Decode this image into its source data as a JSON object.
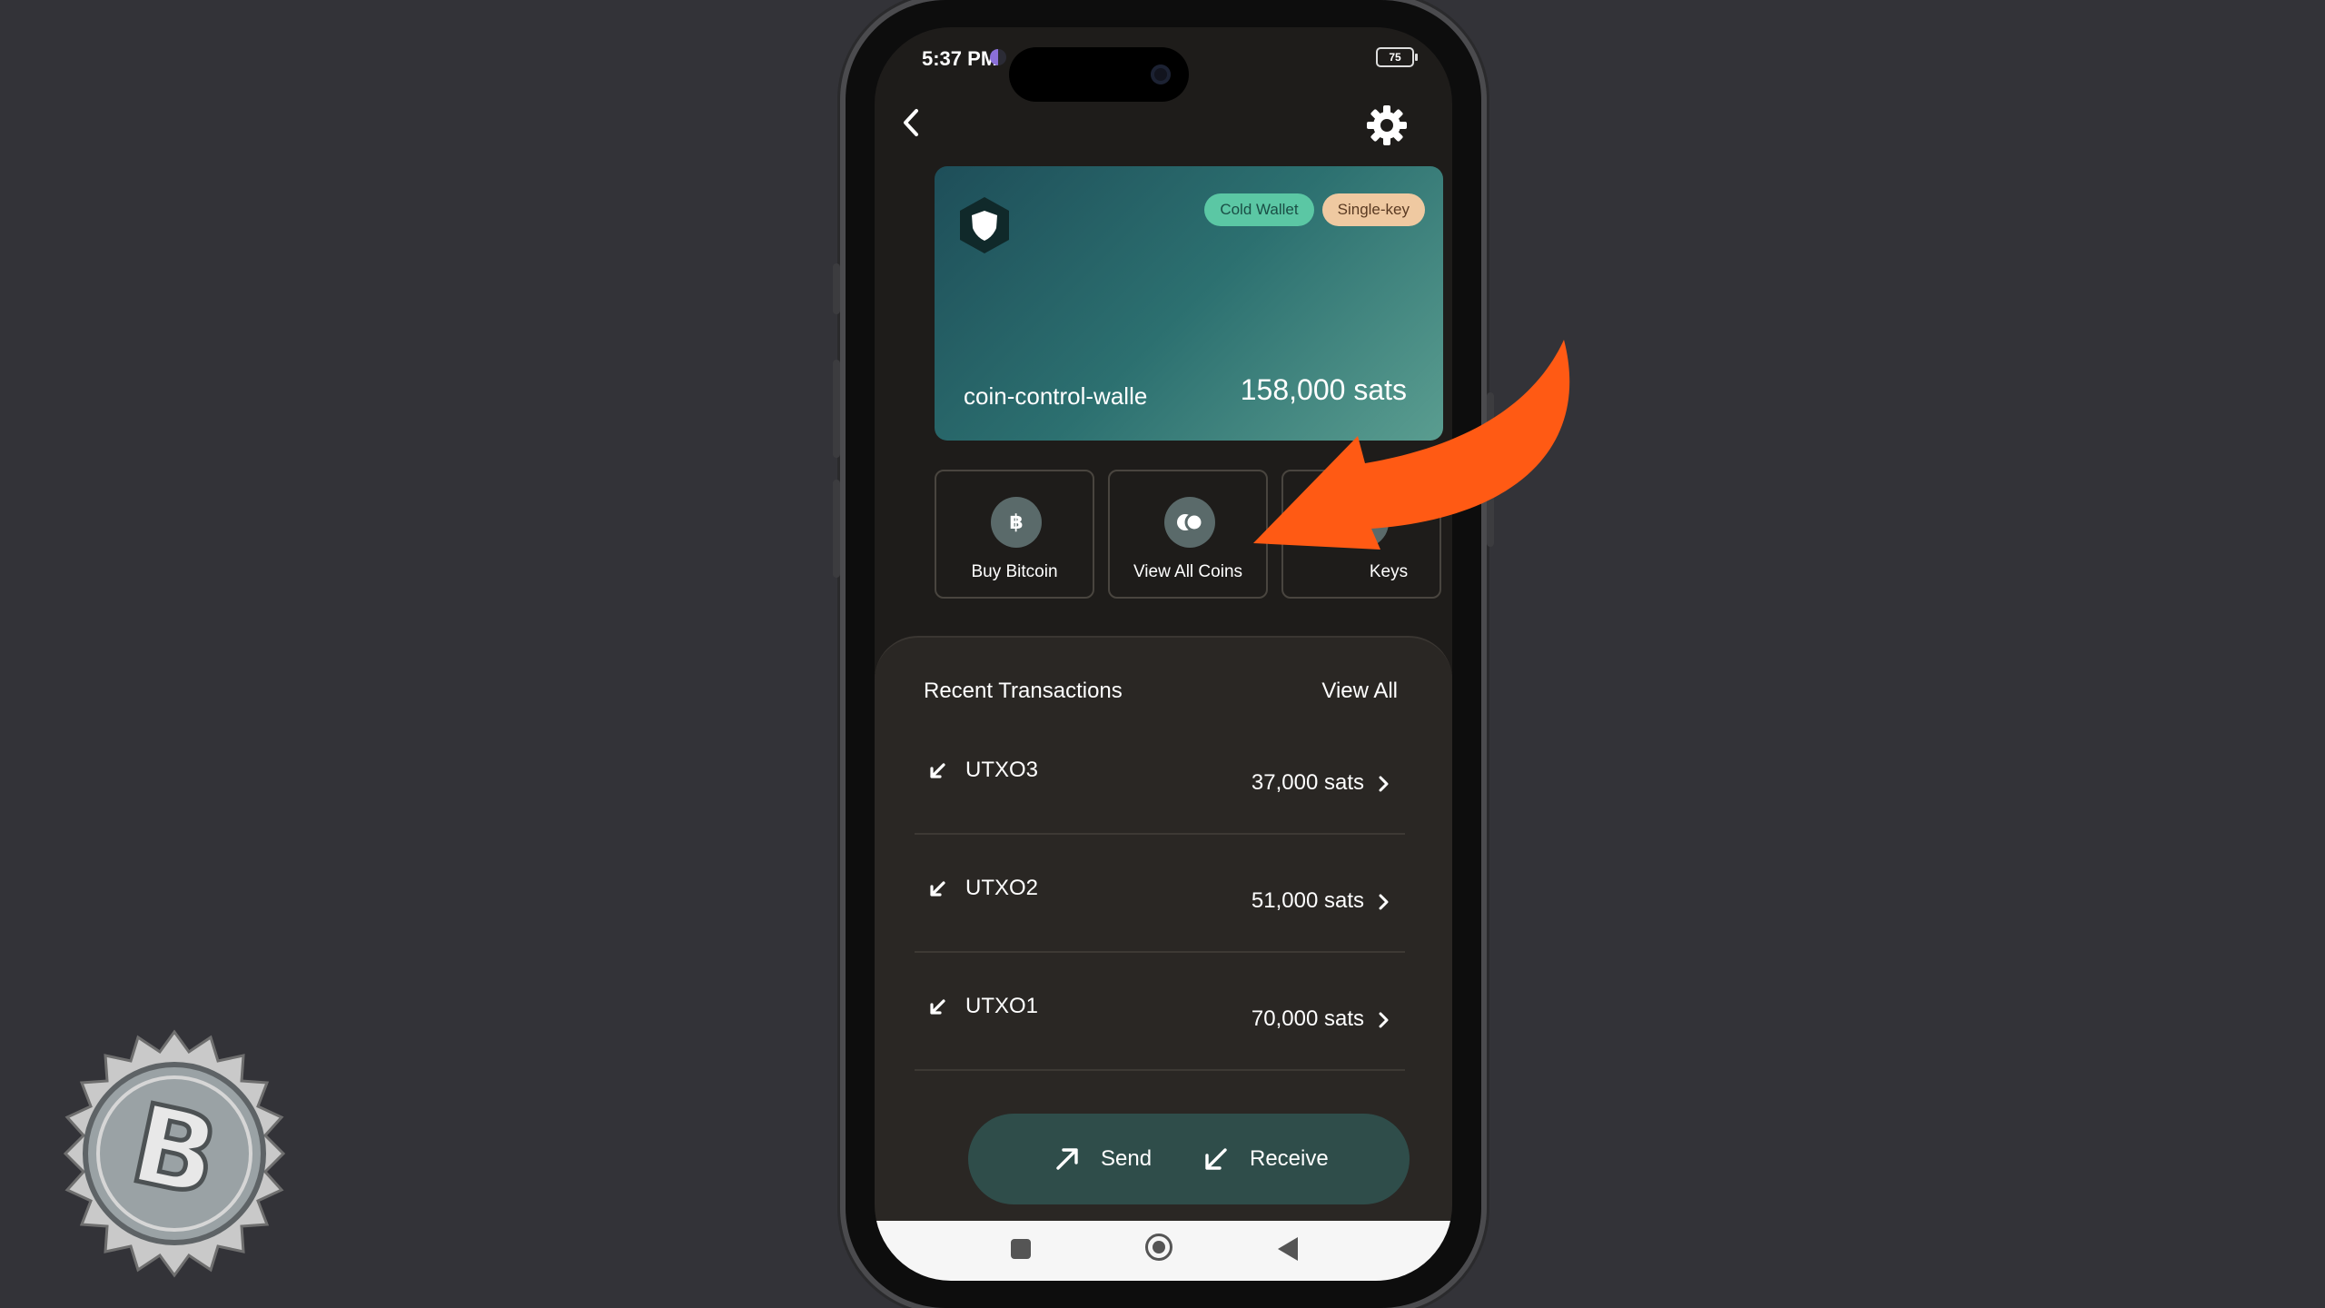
{
  "status_bar": {
    "time": "5:37 PM",
    "battery": "75"
  },
  "wallet": {
    "name": "coin-control-walle",
    "balance": "158,000 sats",
    "badges": [
      "Cold Wallet",
      "Single-key"
    ],
    "colors": {
      "card_start": "#1e4e59",
      "card_end": "#5a9d90",
      "cold_badge": "#5bc7a4",
      "single_badge": "#efc9a1"
    }
  },
  "actions": [
    {
      "label": "Buy Bitcoin",
      "icon": "bitcoin-icon"
    },
    {
      "label": "View All Coins",
      "icon": "coins-icon"
    },
    {
      "label": "Keys",
      "icon": "key-icon"
    }
  ],
  "transactions": {
    "title": "Recent Transactions",
    "view_all": "View All",
    "items": [
      {
        "name": "UTXO3",
        "amount": "37,000 sats",
        "icon": "receive-arrow-icon"
      },
      {
        "name": "UTXO2",
        "amount": "51,000 sats",
        "icon": "receive-arrow-icon"
      },
      {
        "name": "UTXO1",
        "amount": "70,000 sats",
        "icon": "receive-arrow-icon"
      }
    ]
  },
  "bottom_actions": {
    "send": "Send",
    "receive": "Receive"
  },
  "overlay": {
    "arrow_color": "#ff5a14"
  }
}
